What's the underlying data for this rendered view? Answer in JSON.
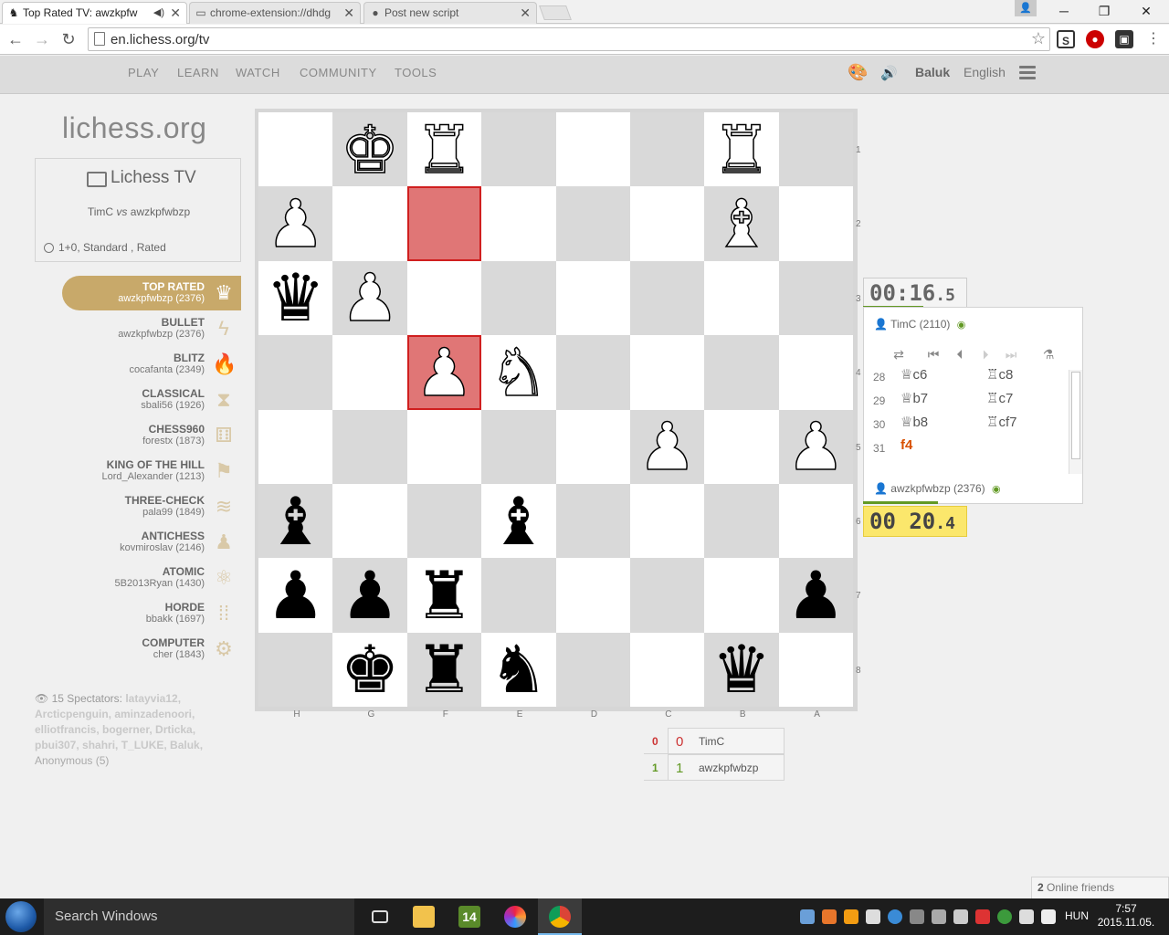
{
  "browser": {
    "tabs": [
      {
        "title": "Top Rated TV: awzkpfw",
        "active": true
      },
      {
        "title": "chrome-extension://dhdg",
        "active": false
      },
      {
        "title": "Post new script",
        "active": false
      }
    ],
    "url": "en.lichess.org/tv",
    "extensions": [
      "S",
      "ABP",
      "1",
      "1"
    ]
  },
  "header": {
    "nav": [
      "PLAY",
      "LEARN",
      "WATCH",
      "COMMUNITY",
      "TOOLS"
    ],
    "username": "Baluk",
    "language": "English"
  },
  "sidebar": {
    "logo": "lichess.org",
    "tv_title": "Lichess TV",
    "white_player": "TimC",
    "vs": "vs",
    "black_player": "awzkpfwbzp",
    "game_meta": "1+0, Standard , Rated",
    "channels": [
      {
        "name": "TOP RATED",
        "player": "awzkpfwbzp (2376)",
        "icon": "♛",
        "active": true
      },
      {
        "name": "BULLET",
        "player": "awzkpfwbzp (2376)",
        "icon": "ϟ"
      },
      {
        "name": "BLITZ",
        "player": "cocafanta (2349)",
        "icon": "🔥"
      },
      {
        "name": "CLASSICAL",
        "player": "sbali56 (1926)",
        "icon": "⧗"
      },
      {
        "name": "CHESS960",
        "player": "forestx (1873)",
        "icon": "⚅"
      },
      {
        "name": "KING OF THE HILL",
        "player": "Lord_Alexander (1213)",
        "icon": "⚑"
      },
      {
        "name": "THREE-CHECK",
        "player": "pala99 (1849)",
        "icon": "≋"
      },
      {
        "name": "ANTICHESS",
        "player": "kovmiroslav (2146)",
        "icon": "♟"
      },
      {
        "name": "ATOMIC",
        "player": "5B2013Ryan (1430)",
        "icon": "⚛"
      },
      {
        "name": "HORDE",
        "player": "bbakk (1697)",
        "icon": "⁞⁞"
      },
      {
        "name": "COMPUTER",
        "player": "cher (1843)",
        "icon": "⚙"
      }
    ],
    "spectators_label": "15 Spectators:",
    "spectators": "latayvia12, Arcticpenguin, aminzadenoori, elliotfrancis, bogerner, Drticka, pbui307, shahri, T_LUKE, Baluk,",
    "anonymous": "Anonymous (5)"
  },
  "board": {
    "ranks": [
      "1",
      "2",
      "3",
      "4",
      "5",
      "6",
      "7",
      "8"
    ],
    "files": [
      "H",
      "G",
      "F",
      "E",
      "D",
      "C",
      "B",
      "A"
    ],
    "rows": [
      [
        "",
        "wK",
        "wR",
        "",
        "",
        "",
        "wR",
        ""
      ],
      [
        "wP",
        "",
        "",
        "",
        "",
        "",
        "wB",
        ""
      ],
      [
        "bQ",
        "wP",
        "",
        "",
        "",
        "",
        "",
        ""
      ],
      [
        "",
        "",
        "wP",
        "wN",
        "",
        "",
        "",
        ""
      ],
      [
        "",
        "",
        "",
        "",
        "",
        "wP",
        "",
        "wP"
      ],
      [
        "bB",
        "",
        "",
        "bB",
        "",
        "",
        "",
        ""
      ],
      [
        "bP",
        "bP",
        "bR",
        "",
        "",
        "",
        "",
        "bP"
      ],
      [
        "",
        "bK",
        "bR",
        "bN",
        "",
        "",
        "bQ",
        ""
      ]
    ],
    "highlights": [
      "1-2",
      "3-2"
    ]
  },
  "game": {
    "top_clock": "00:16",
    "top_clock_tenths": ".5",
    "bottom_clock": "00 20",
    "bottom_clock_tenths": ".4",
    "top_player": "TimC (2110)",
    "bottom_player": "awzkpfwbzp (2376)",
    "moves": [
      {
        "num": "28",
        "white": "♕c6",
        "black": "♖c8"
      },
      {
        "num": "29",
        "white": "♕b7",
        "black": "♖c7"
      },
      {
        "num": "30",
        "white": "♕b8",
        "black": "♖cf7"
      },
      {
        "num": "31",
        "white": "f4",
        "black": ""
      }
    ]
  },
  "crosstable": [
    {
      "score": "0",
      "big": "0",
      "name": "TimC",
      "result": "loss"
    },
    {
      "score": "1",
      "big": "1",
      "name": "awzkpfwbzp",
      "result": "win"
    }
  ],
  "friends": {
    "count": "2",
    "label": "Online friends"
  },
  "taskbar": {
    "search_placeholder": "Search Windows",
    "app_badge": "14",
    "lang": "HUN",
    "time": "7:57",
    "date": "2015.11.05."
  }
}
